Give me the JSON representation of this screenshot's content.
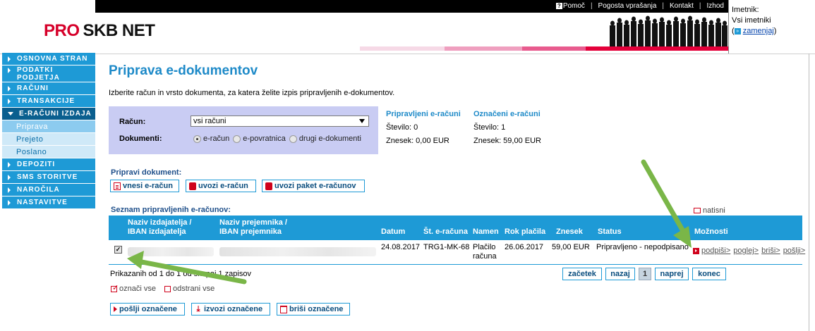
{
  "header": {
    "logo_pro": "PRO",
    "logo_rest": "SKB NET",
    "links": [
      "Pomoč",
      "Pogosta vprašanja",
      "Kontakt",
      "Izhod"
    ],
    "owner_label": "Imetnik:",
    "owner_value": "Vsi imetniki",
    "owner_change": "zamenjaj",
    "owner_open": "(",
    "owner_close": ")"
  },
  "sidebar": {
    "items": [
      {
        "label": "OSNOVNA STRAN"
      },
      {
        "label": "PODATKI PODJETJA"
      },
      {
        "label": "RAČUNI"
      },
      {
        "label": "TRANSAKCIJE"
      },
      {
        "label": "E-RAČUNI IZDAJA"
      },
      {
        "label": "DEPOZITI"
      },
      {
        "label": "SMS STORITVE"
      },
      {
        "label": "NAROČILA"
      },
      {
        "label": "NASTAVITVE"
      }
    ],
    "subitems": [
      "Priprava",
      "Prejeto",
      "Poslano"
    ]
  },
  "main": {
    "title": "Priprava e-dokumentov",
    "intro": "Izberite račun in vrsto dokumenta, za katera želite izpis pripravljenih e-dokumentov.",
    "filter": {
      "account_label": "Račun:",
      "account_value": "vsi računi",
      "documents_label": "Dokumenti:",
      "radio_options": [
        "e-račun",
        "e-povratnica",
        "drugi e-dokumenti"
      ]
    },
    "prepared": {
      "title": "Pripravljeni e-računi",
      "count": "Število: 0",
      "amount": "Znesek: 0,00 EUR"
    },
    "marked": {
      "title": "Označeni e-računi",
      "count": "Število: 1",
      "amount": "Znesek: 59,00 EUR"
    },
    "prepare_title": "Pripravi dokument:",
    "prepare_buttons": [
      "vnesi e-račun",
      "uvozi e-račun",
      "uvozi paket e-računov"
    ],
    "list_title": "Seznam pripravljenih e-računov:",
    "print_label": "natisni",
    "table": {
      "headers": {
        "issuer_1": "Naziv izdajatelja /",
        "issuer_2": "IBAN izdajatelja",
        "recipient_1": "Naziv prejemnika /",
        "recipient_2": "IBAN prejemnika",
        "date": "Datum",
        "number": "Št. e-računa",
        "purpose": "Namen",
        "due": "Rok plačila",
        "amount": "Znesek",
        "status": "Status",
        "options": "Možnosti"
      },
      "rows": [
        {
          "checked": "✓",
          "date": "24.08.2017",
          "number": "TRG1-MK-68",
          "purpose_1": "Plačilo",
          "purpose_2": "računa",
          "due": "26.06.2017",
          "amount": "59,00 EUR",
          "status": "Pripravljeno - nepodpisano",
          "actions": [
            "podpiši>",
            "poglej>",
            "briši>",
            "pošlji>"
          ]
        }
      ]
    },
    "count_text": "Prikazanih od 1 do 1 od skupaj 1 zapisov",
    "pager": [
      "začetek",
      "nazaj",
      "1",
      "naprej",
      "konec"
    ],
    "mark_all": "označi vse",
    "unmark_all": "odstrani vse",
    "bottom_buttons": [
      "pošlji označene",
      "izvozi označene",
      "briši označene"
    ]
  },
  "colors": {
    "accent": "#1e9ad6",
    "title": "#1e8ac8",
    "brand_red": "#d6002a",
    "arrow": "#7ab648"
  }
}
